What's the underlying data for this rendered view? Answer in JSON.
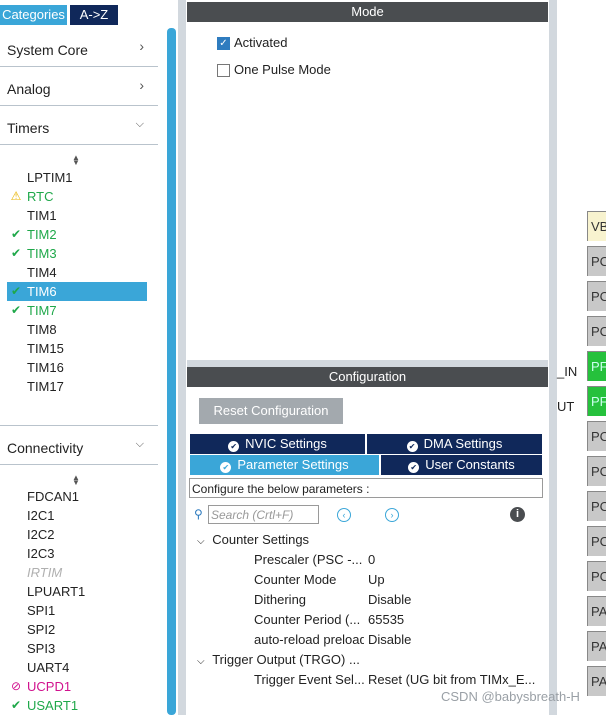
{
  "left": {
    "tabs": {
      "categories": "Categories",
      "az": "A->Z"
    },
    "categories": [
      {
        "label": "System Core",
        "chevron": ">"
      },
      {
        "label": "Analog",
        "chevron": ">"
      },
      {
        "label": "Timers",
        "chevron": "v"
      },
      {
        "label": "Connectivity",
        "chevron": "v"
      }
    ],
    "timers": [
      "LPTIM1",
      "RTC",
      "TIM1",
      "TIM2",
      "TIM3",
      "TIM4",
      "TIM6",
      "TIM7",
      "TIM8",
      "TIM15",
      "TIM16",
      "TIM17"
    ],
    "connectivity": [
      "FDCAN1",
      "I2C1",
      "I2C2",
      "I2C3",
      "IRTIM",
      "LPUART1",
      "SPI1",
      "SPI2",
      "SPI3",
      "UART4",
      "UCPD1",
      "USART1"
    ]
  },
  "mode": {
    "title": "Mode",
    "activated": "Activated",
    "one_pulse": "One Pulse Mode"
  },
  "config": {
    "title": "Configuration",
    "reset": "Reset Configuration",
    "tabs": {
      "nvic": "NVIC Settings",
      "dma": "DMA Settings",
      "param": "Parameter Settings",
      "user": "User Constants"
    },
    "configure_line": "Configure the below parameters :",
    "search_placeholder": "Search (Crtl+F)",
    "groups": {
      "counter": "Counter Settings",
      "trigger": "Trigger Output (TRGO) ..."
    },
    "params": [
      {
        "name": "Prescaler (PSC -...",
        "value": "0"
      },
      {
        "name": "Counter Mode",
        "value": "Up"
      },
      {
        "name": "Dithering",
        "value": "Disable"
      },
      {
        "name": "Counter Period (...",
        "value": "65535"
      },
      {
        "name": "auto-reload preload",
        "value": "Disable"
      }
    ],
    "trigger_param": {
      "name": "Trigger Event Sel...",
      "value": "Reset (UG bit from TIMx_E..."
    }
  },
  "pins": {
    "labels": [
      "VB",
      "PC",
      "PC",
      "PC",
      "PF",
      "PF",
      "PC",
      "PC",
      "PC",
      "PC",
      "PC",
      "PA",
      "PA",
      "PA"
    ],
    "side_labels": [
      "_IN",
      "UT"
    ]
  },
  "watermark": "CSDN @babysbreath-H"
}
